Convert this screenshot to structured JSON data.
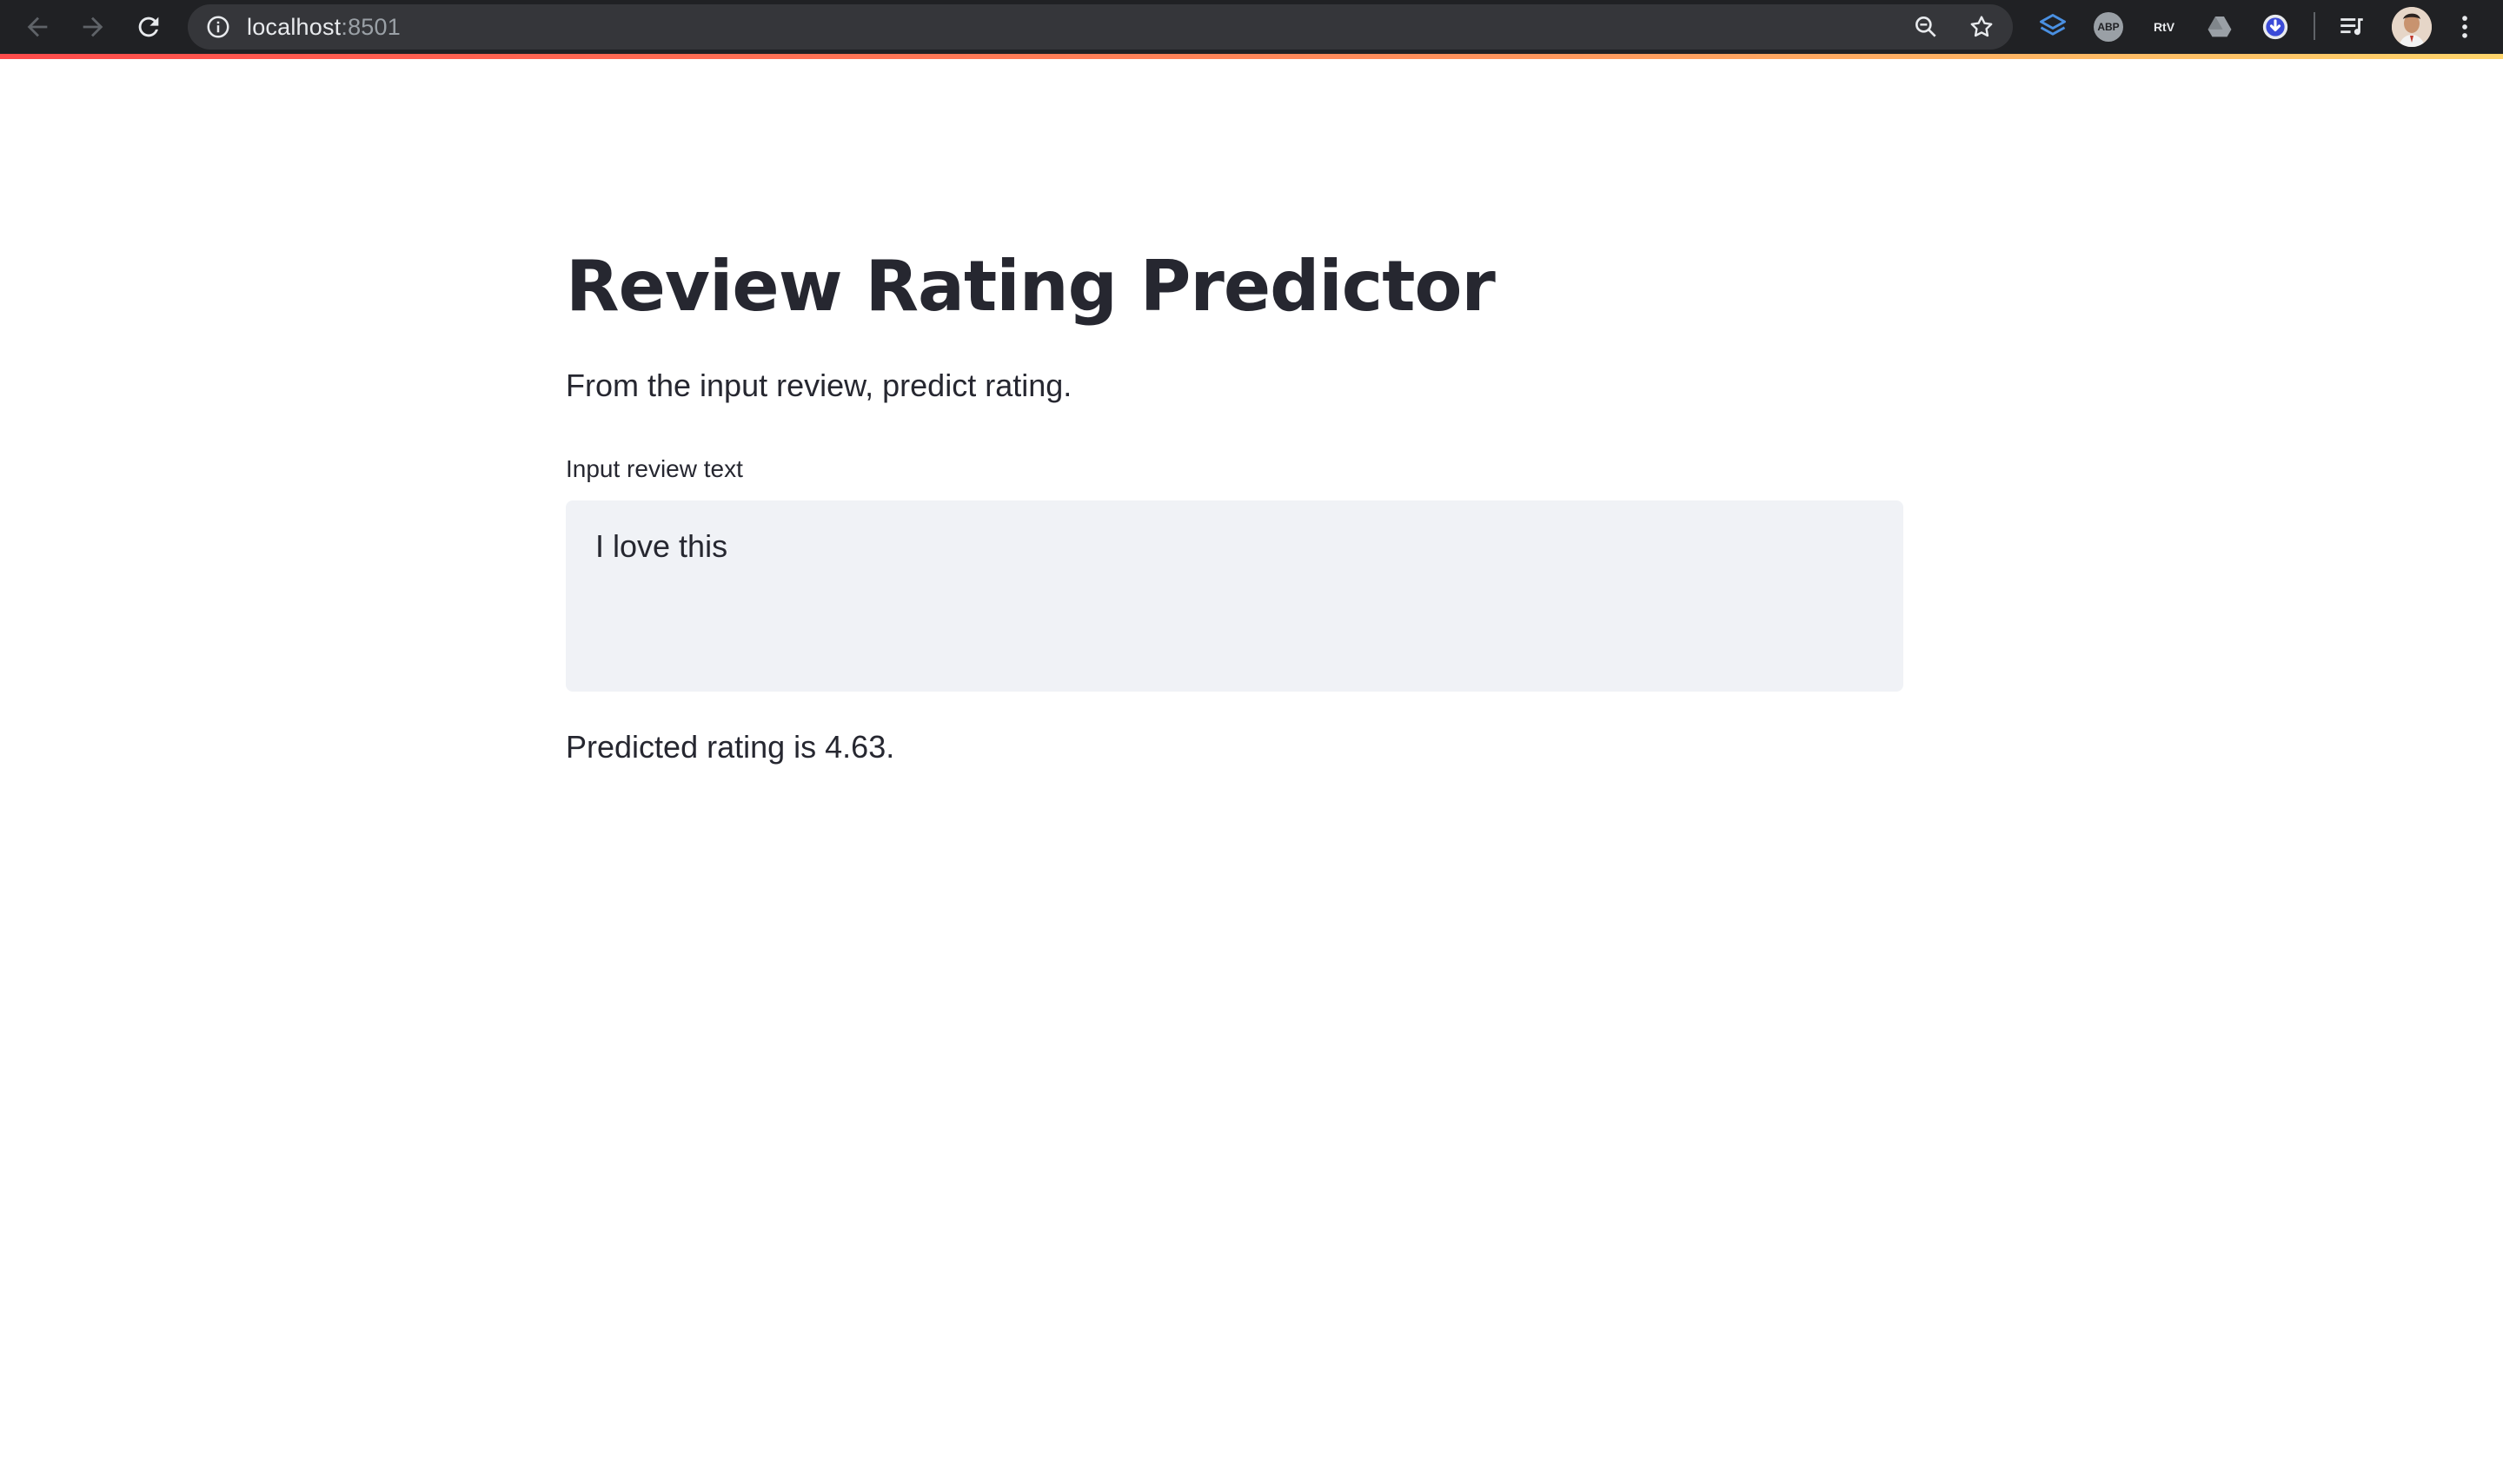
{
  "browser": {
    "url_host": "localhost",
    "url_port": ":8501",
    "extensions": {
      "abp_label": "ABP",
      "rtv_label": "RtV"
    },
    "icons": {
      "back": "back-arrow-icon",
      "forward": "forward-arrow-icon",
      "reload": "reload-icon",
      "site_info": "info-icon",
      "zoom": "zoom-icon",
      "bookmark": "star-icon",
      "layers_extension": "layers-icon",
      "drive_extension": "drive-icon",
      "download_extension": "download-icon",
      "media_control": "playlist-icon",
      "menu": "more-vert-icon"
    },
    "colors": {
      "toolbar": "#202124",
      "omnibox": "#35363a",
      "url_text": "#e8eaed",
      "url_port": "#9aa0a6"
    }
  },
  "app": {
    "decoration_colors": [
      "#ff4b4b",
      "#ff8c5a",
      "#ffd56b"
    ],
    "title": "Review Rating Predictor",
    "description": "From the input review, predict rating.",
    "review_field": {
      "label": "Input review text",
      "value": "I love this"
    },
    "prediction": "Predicted rating is 4.63.",
    "colors": {
      "text": "#262730",
      "input_background": "#f0f2f6",
      "background": "#ffffff"
    }
  }
}
